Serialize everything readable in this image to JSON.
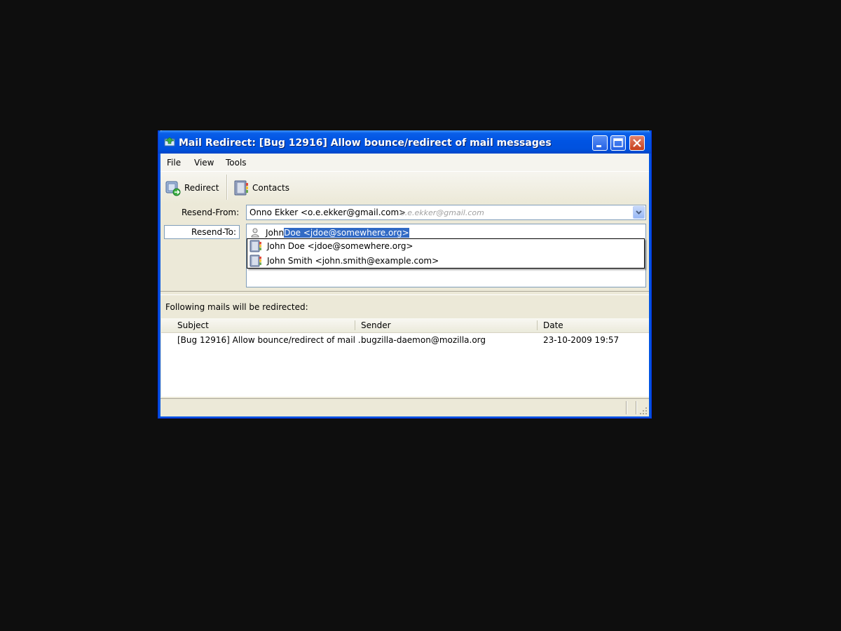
{
  "window": {
    "title": "Mail Redirect: [Bug 12916] Allow bounce/redirect of mail messages"
  },
  "menu": {
    "file": "File",
    "view": "View",
    "tools": "Tools"
  },
  "toolbar": {
    "redirect_label": "Redirect",
    "contacts_label": "Contacts"
  },
  "form": {
    "resend_from_label": "Resend-From:",
    "resend_from_value": "Onno Ekker <o.e.ekker@gmail.com>",
    "resend_from_hint": "o.e.ekker@gmail.com",
    "resend_to_label": "Resend-To:",
    "resend_to_typed": "John",
    "resend_to_completion": " Doe <jdoe@somewhere.org>"
  },
  "autocomplete": {
    "items": [
      {
        "label": "John Doe <jdoe@somewhere.org>"
      },
      {
        "label": "John Smith <john.smith@example.com>"
      }
    ]
  },
  "messages": {
    "info": "Following mails will be redirected:",
    "columns": {
      "subject": "Subject",
      "sender": "Sender",
      "date": "Date"
    },
    "rows": [
      {
        "subject": "[Bug 12916] Allow bounce/redirect of mail ...",
        "sender": "bugzilla-daemon@mozilla.org",
        "date": "23-10-2009 19:57"
      }
    ]
  },
  "colors": {
    "titlebar": "#0054e3",
    "selection": "#316ac5",
    "background": "#ece9d8"
  }
}
